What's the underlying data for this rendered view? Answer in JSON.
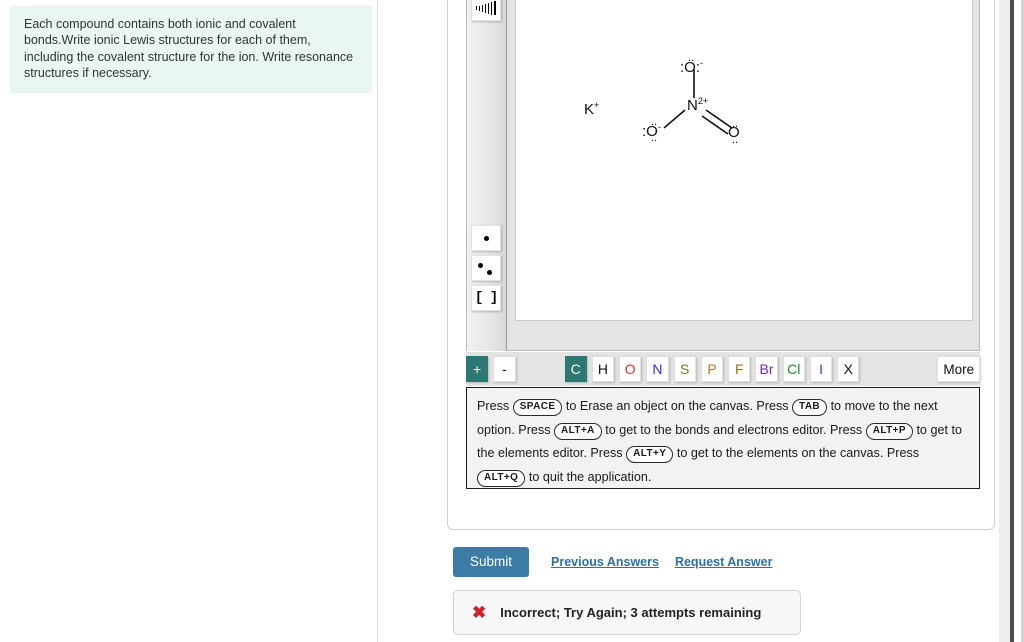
{
  "question": {
    "text": "Each compound contains both ionic and covalent bonds.Write ionic Lewis structures for each of them, including the covalent structure for the ion. Write resonance structures if necessary."
  },
  "editor": {
    "tools": [
      {
        "name": "wedge-bond-tool",
        "icon": "wedge-icon"
      },
      {
        "name": "hash-bond-tool",
        "icon": "hash-icon"
      },
      {
        "name": "single-electron-tool",
        "icon": "dot-icon"
      },
      {
        "name": "lone-pair-tool",
        "icon": "two-dots-icon"
      },
      {
        "name": "bracket-tool",
        "icon": "brackets-icon",
        "label": "[ ]"
      }
    ],
    "charge_buttons": [
      {
        "label": "+",
        "selected": true
      },
      {
        "label": "-",
        "selected": false
      }
    ],
    "elements": [
      {
        "label": "C",
        "color": "#ffffff",
        "selected": true
      },
      {
        "label": "H",
        "color": "#111111",
        "selected": false
      },
      {
        "label": "O",
        "color": "#e03127",
        "selected": false
      },
      {
        "label": "N",
        "color": "#2030d8",
        "selected": false
      },
      {
        "label": "S",
        "color": "#7a7a22",
        "selected": false
      },
      {
        "label": "P",
        "color": "#c07818",
        "selected": false
      },
      {
        "label": "F",
        "color": "#a07010",
        "selected": false
      },
      {
        "label": "Br",
        "color": "#7a22c0",
        "selected": false
      },
      {
        "label": "Cl",
        "color": "#1a8a2a",
        "selected": false
      },
      {
        "label": "I",
        "color": "#7a22c0",
        "selected": false
      },
      {
        "label": "X",
        "color": "#111111",
        "selected": false
      }
    ],
    "more_label": "More",
    "selected_accent": "#2d7873",
    "instructions": {
      "s1": "Press",
      "k1": "SPACE",
      "s2": "to Erase an object on the canvas. Press",
      "k2": "TAB",
      "s3": "to move to the next option. Press",
      "k3": "ALT+A",
      "s4": "to get to the bonds and electrons editor. Press",
      "k4": "ALT+P",
      "s5": "to get to the elements editor. Press",
      "k5": "ALT+Y",
      "s6": "to get to the elements on the canvas. Press",
      "k6": "ALT+Q",
      "s7": "to quit the application."
    }
  },
  "canvas": {
    "description": "Lewis structure of potassium ion and a nitrate-type anion",
    "cation": {
      "symbol": "K",
      "charge": "+"
    },
    "anion": {
      "center": {
        "symbol": "N",
        "charge": "2+"
      },
      "oxygens": [
        {
          "position": "top",
          "symbol": "O",
          "charge": "-",
          "bond": "single",
          "lone_pairs": 3
        },
        {
          "position": "bottom-left",
          "symbol": "O",
          "charge": "-",
          "bond": "single",
          "lone_pairs": 3
        },
        {
          "position": "bottom-right",
          "symbol": "O",
          "charge": "",
          "bond": "double",
          "lone_pairs": 2
        }
      ]
    }
  },
  "actions": {
    "submit_label": "Submit",
    "previous_answers_label": "Previous Answers",
    "request_answer_label": "Request Answer",
    "submit_color": "#3a7ca5"
  },
  "feedback": {
    "icon": "x-mark",
    "text": "Incorrect; Try Again; 3 attempts remaining",
    "icon_color": "#d0222b"
  }
}
